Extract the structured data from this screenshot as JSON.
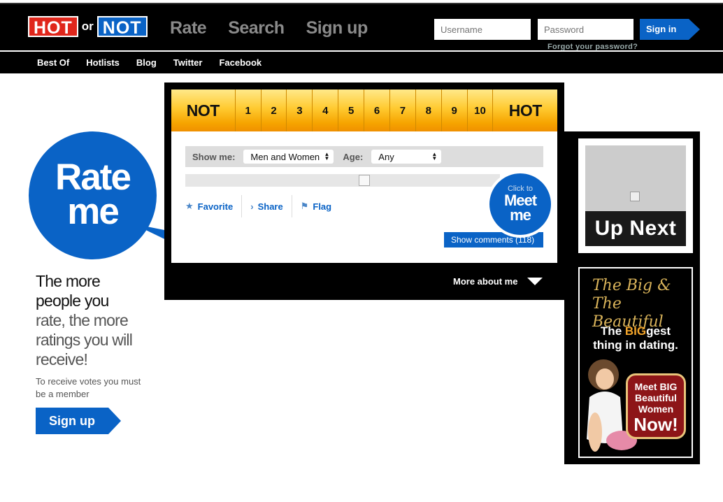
{
  "header": {
    "logo": {
      "hot": "HOT",
      "or": "or",
      "not": "NOT"
    },
    "nav": [
      "Rate",
      "Search",
      "Sign up"
    ],
    "login": {
      "username_placeholder": "Username",
      "password_placeholder": "Password",
      "signin_label": "Sign in",
      "forgot_label": "Forgot your password?"
    }
  },
  "subnav": [
    "Best Of",
    "Hotlists",
    "Blog",
    "Twitter",
    "Facebook"
  ],
  "promo": {
    "bubble_line1": "Rate",
    "bubble_line2": "me",
    "headline_line1": "The more",
    "headline_line2": "people you",
    "headline_line3": "rate, the more",
    "headline_line4": "ratings you will",
    "headline_line5": "receive!",
    "sub": "To receive votes you must be a member",
    "signup_label": "Sign up"
  },
  "rating": {
    "low_label": "NOT",
    "high_label": "HOT",
    "scores": [
      "1",
      "2",
      "3",
      "4",
      "5",
      "6",
      "7",
      "8",
      "9",
      "10"
    ]
  },
  "filters": {
    "show_label": "Show me:",
    "show_value": "Men and Women",
    "age_label": "Age:",
    "age_value": "Any"
  },
  "actions": [
    "Favorite",
    "Share",
    "Flag"
  ],
  "meet": {
    "small": "Click to",
    "line1": "Meet",
    "line2": "me"
  },
  "comments_label": "Show comments (118)",
  "more_about_label": "More about me",
  "up_next_label": "Up Next",
  "ad": {
    "logo_line1": "The Big &",
    "logo_line2": "The Beautiful",
    "tag_pre": "The ",
    "tag_hl": "BIG",
    "tag_post": "gest",
    "tag_line2": "thing in dating.",
    "cta_line1": "Meet BIG",
    "cta_line2": "Beautiful",
    "cta_line3": "Women",
    "cta_line4": "Now!"
  },
  "colors": {
    "brand_blue": "#0a63c6",
    "hot_red": "#e0261b",
    "rating_orange": "#f6a400"
  }
}
